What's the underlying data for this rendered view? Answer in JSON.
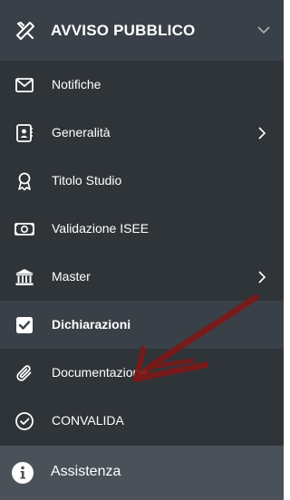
{
  "header": {
    "title": "AVVISO PUBBLICO",
    "icon": "tools-icon",
    "chevron": "chevron-down-icon"
  },
  "menu": {
    "items": [
      {
        "label": "Notifiche",
        "icon": "envelope-icon"
      },
      {
        "label": "Generalità",
        "icon": "id-card-icon",
        "has_submenu": true
      },
      {
        "label": "Titolo Studio",
        "icon": "award-icon"
      },
      {
        "label": "Validazione ISEE",
        "icon": "money-bill-icon"
      },
      {
        "label": "Master",
        "icon": "university-icon",
        "has_submenu": true
      },
      {
        "label": "Dichiarazioni",
        "icon": "check-square-icon",
        "active": true
      },
      {
        "label": "Documentazione",
        "icon": "paperclip-icon"
      },
      {
        "label": "CONVALIDA",
        "icon": "check-circle-icon"
      }
    ]
  },
  "footer": {
    "assist_label": "Assistenza",
    "icon": "info-circle-icon"
  },
  "colors": {
    "sidebar_bg": "#2f3439",
    "header_bg": "#3a4047",
    "active_bg": "#3a4047",
    "footer_bg": "#4a5159",
    "annotation_arrow": "#8b1a1a"
  }
}
